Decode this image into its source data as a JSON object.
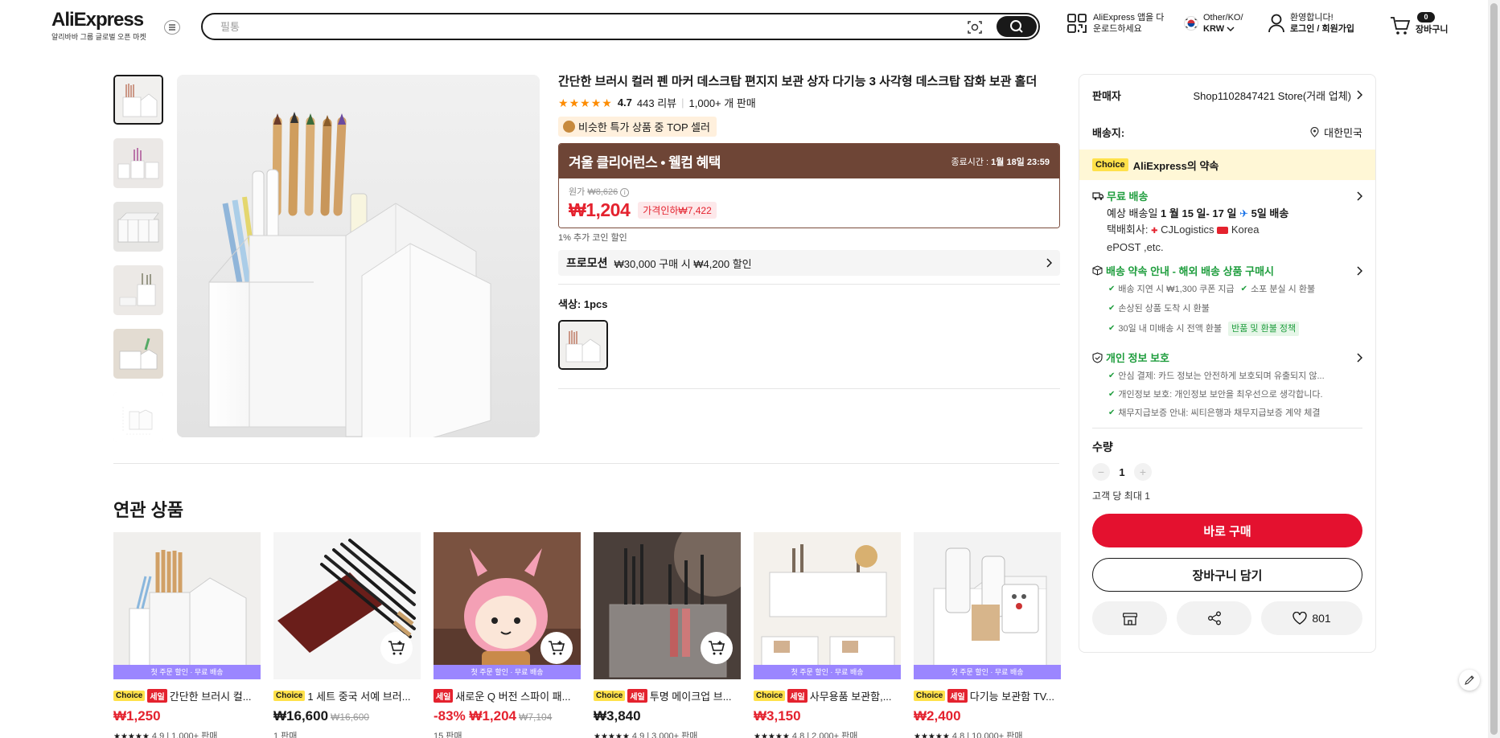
{
  "header": {
    "logo": "AliExpress",
    "logo_sub": "알리바바 그룹 글로벌 오픈 마켓",
    "search_placeholder": "필통",
    "app_download_line1": "AliExpress 앱을 다",
    "app_download_line2": "운로드하세요",
    "region_line1": "Other/KO/",
    "region_line2": "KRW",
    "account_line1": "환영합니다!",
    "account_line2": "로그인 / 회원가입",
    "cart_count": "0",
    "cart_label": "장바구니"
  },
  "product": {
    "title": "간단한 브러시 컬러 펜 마커 데스크탑 편지지 보관 상자 다기능 3 사각형 데스크탑 잡화 보관 홀더",
    "rating": "4.7",
    "rating_stars": 4.7,
    "reviews": "443 리뷰",
    "sold": "1,000+ 개 판매",
    "top_seller": "비슷한 특가 상품 중 TOP 셀러",
    "deal_title": "겨울 클리어런스 • 웰컴 혜택",
    "deal_end_label": "종료시간 :",
    "deal_end_time": "1월 18일 23:59",
    "original_label": "원가",
    "original_price": "₩8,626",
    "price": "₩1,204",
    "discount": "가격인하₩7,422",
    "coin_note": "1% 추가 코인 할인",
    "promo_label": "프로모션",
    "promo_text": "₩30,000 구매 시 ₩4,200 할인",
    "color_label": "색상: 1pcs"
  },
  "panel": {
    "seller_label": "판매자",
    "seller_value": "Shop1102847421 Store(거래 업체)",
    "ship_to_label": "배송지:",
    "ship_to_value": "대한민국",
    "choice_badge": "Choice",
    "choice_text": "AliExpress의 약속",
    "free_shipping": "무료 배송",
    "eta_prefix": "예상 배송일",
    "eta_dates": "1 월 15 일- 17 일",
    "eta_fast": "5일 배송",
    "courier_label": "택배회사:",
    "courier_1": "CJLogistics",
    "courier_2": "Korea",
    "courier_3": "ePOST ,etc.",
    "promise_title": "배송 약속 안내 - 해외 배송 상품 구매시",
    "promise_1": "배송 지연 시 ₩1,300 쿠폰 지급",
    "promise_2": "소포 분실 시 환불",
    "promise_3": "손상된 상품 도착 시 환불",
    "promise_4": "30일 내 미배송 시 전액 환불",
    "policy_tag": "반품 및 환불 정책",
    "privacy_title": "개인 정보 보호",
    "privacy_1": "안심 결제: 카드 정보는 안전하게 보호되며 유출되지 않...",
    "privacy_2": "개인정보 보호: 개인정보 보안을 최우선으로 생각합니다.",
    "privacy_3": "채무지급보증 안내: 씨티은행과 채무지급보증 계약 체결",
    "qty_label": "수량",
    "qty_value": "1",
    "qty_limit": "고객 당 최대 1",
    "buy_now": "바로 구매",
    "add_cart": "장바구니 담기",
    "wishlist_count": "801"
  },
  "related": {
    "title": "연관 상품",
    "banner_text": "첫 주문 할인 · 무료 배송",
    "items": [
      {
        "choice": "Choice",
        "sale": "세일",
        "title": "간단한 브러시 컬...",
        "price": "₩1,250",
        "old_price": "",
        "meta": "4.9 | 1,000+ 판매",
        "rating": 4.9,
        "red": true
      },
      {
        "choice": "Choice",
        "sale": "",
        "title": "1 세트 중국 서예 브러...",
        "price": "₩16,600",
        "old_price": "₩16,600",
        "meta": "1 판매",
        "rating": 0,
        "red": false
      },
      {
        "choice": "",
        "sale": "세일",
        "title": "새로운 Q 버전 스파이 패...",
        "price": "-83% ₩1,204",
        "old_price": "₩7,104",
        "meta": "15 판매",
        "rating": 0,
        "red": true
      },
      {
        "choice": "Choice",
        "sale": "세일",
        "title": "투명 메이크업 브...",
        "price": "₩3,840",
        "old_price": "",
        "meta": "4.9 | 3,000+ 판매",
        "rating": 4.9,
        "red": false
      },
      {
        "choice": "Choice",
        "sale": "세일",
        "title": "사무용품 보관함,...",
        "price": "₩3,150",
        "old_price": "",
        "meta": "4.8 | 2,000+ 판매",
        "rating": 4.8,
        "red": true
      },
      {
        "choice": "Choice",
        "sale": "세일",
        "title": "다기능 보관함 TV...",
        "price": "₩2,400",
        "old_price": "",
        "meta": "4.8 | 10,000+ 판매",
        "rating": 4.8,
        "red": true
      }
    ]
  },
  "colors": {
    "accent_red": "#e4112f",
    "price_red": "#e4222e",
    "deal_brown": "#6e4536",
    "choice_yellow": "#ffe14a",
    "success_green": "#1e9d3d",
    "banner_purple": "#9b86ff"
  }
}
